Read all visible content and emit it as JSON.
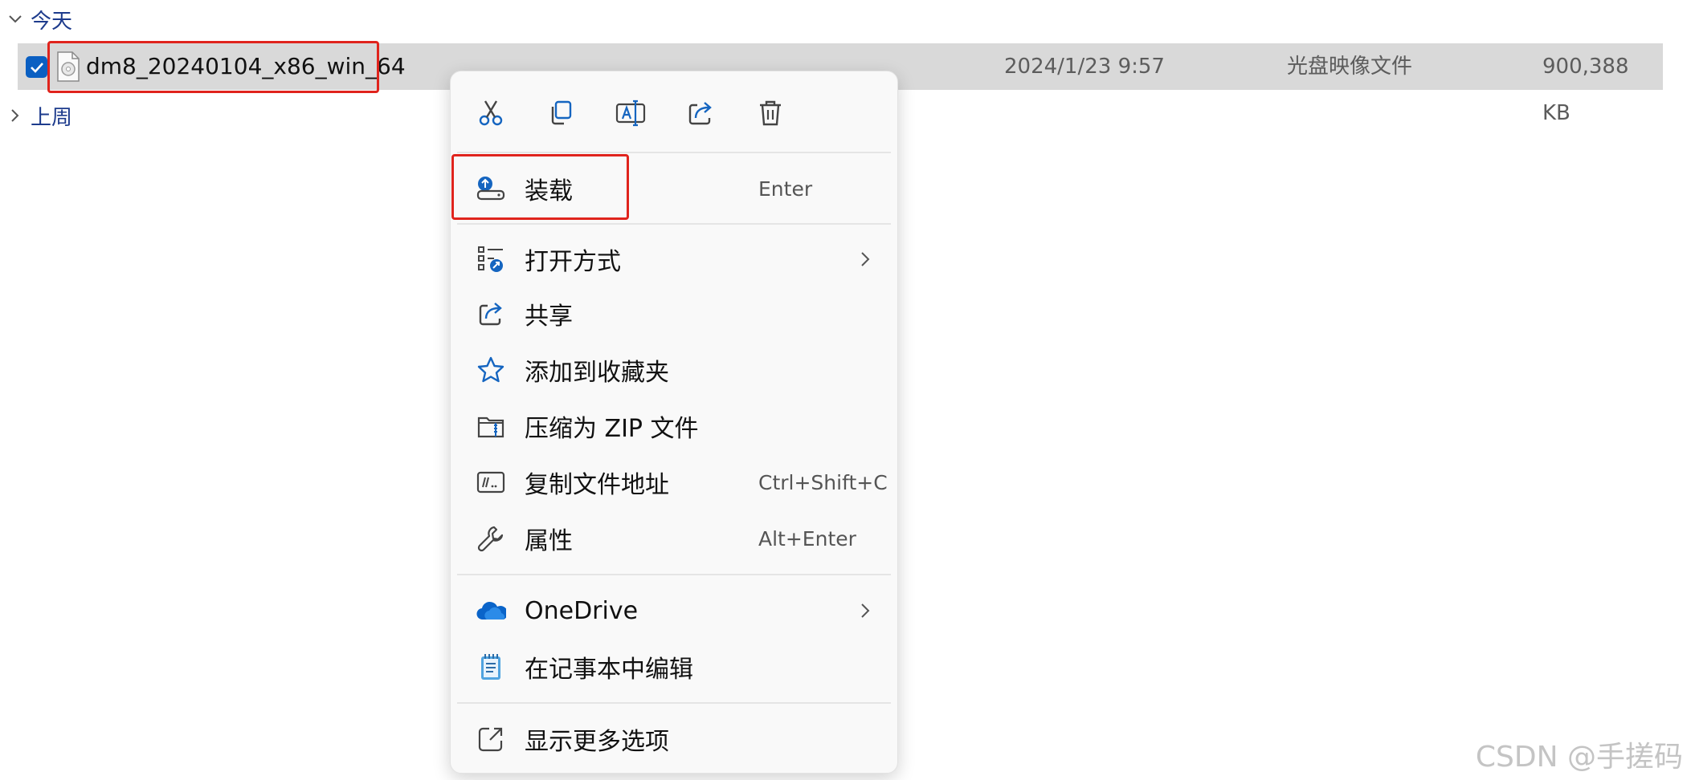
{
  "groups": {
    "today": "今天",
    "last_week": "上周"
  },
  "file": {
    "name": "dm8_20240104_x86_win_64",
    "date": "2024/1/23 9:57",
    "type": "光盘映像文件",
    "size": "900,388 KB",
    "icon": "disc-image-file-icon"
  },
  "context_menu": {
    "quick_actions": [
      "cut-icon",
      "copy-icon",
      "rename-icon",
      "share-icon",
      "delete-icon"
    ],
    "items": [
      {
        "label": "装载",
        "shortcut": "Enter",
        "icon": "mount-icon"
      },
      {
        "label": "打开方式",
        "shortcut": "",
        "icon": "open-with-icon",
        "submenu": true
      },
      {
        "label": "共享",
        "shortcut": "",
        "icon": "share-icon"
      },
      {
        "label": "添加到收藏夹",
        "shortcut": "",
        "icon": "star-icon"
      },
      {
        "label": "压缩为 ZIP 文件",
        "shortcut": "",
        "icon": "zip-icon"
      },
      {
        "label": "复制文件地址",
        "shortcut": "Ctrl+Shift+C",
        "icon": "copy-path-icon"
      },
      {
        "label": "属性",
        "shortcut": "Alt+Enter",
        "icon": "wrench-icon"
      },
      {
        "label": "OneDrive",
        "shortcut": "",
        "icon": "onedrive-icon",
        "submenu": true
      },
      {
        "label": "在记事本中编辑",
        "shortcut": "",
        "icon": "notepad-icon"
      },
      {
        "label": "显示更多选项",
        "shortcut": "",
        "icon": "more-options-icon"
      }
    ]
  },
  "watermark": "CSDN @手搓码",
  "colors": {
    "highlight_box": "#e0241d",
    "selection_bg": "#d9d9d9",
    "accent": "#0a5fc2",
    "group_label": "#1d3b8c"
  }
}
